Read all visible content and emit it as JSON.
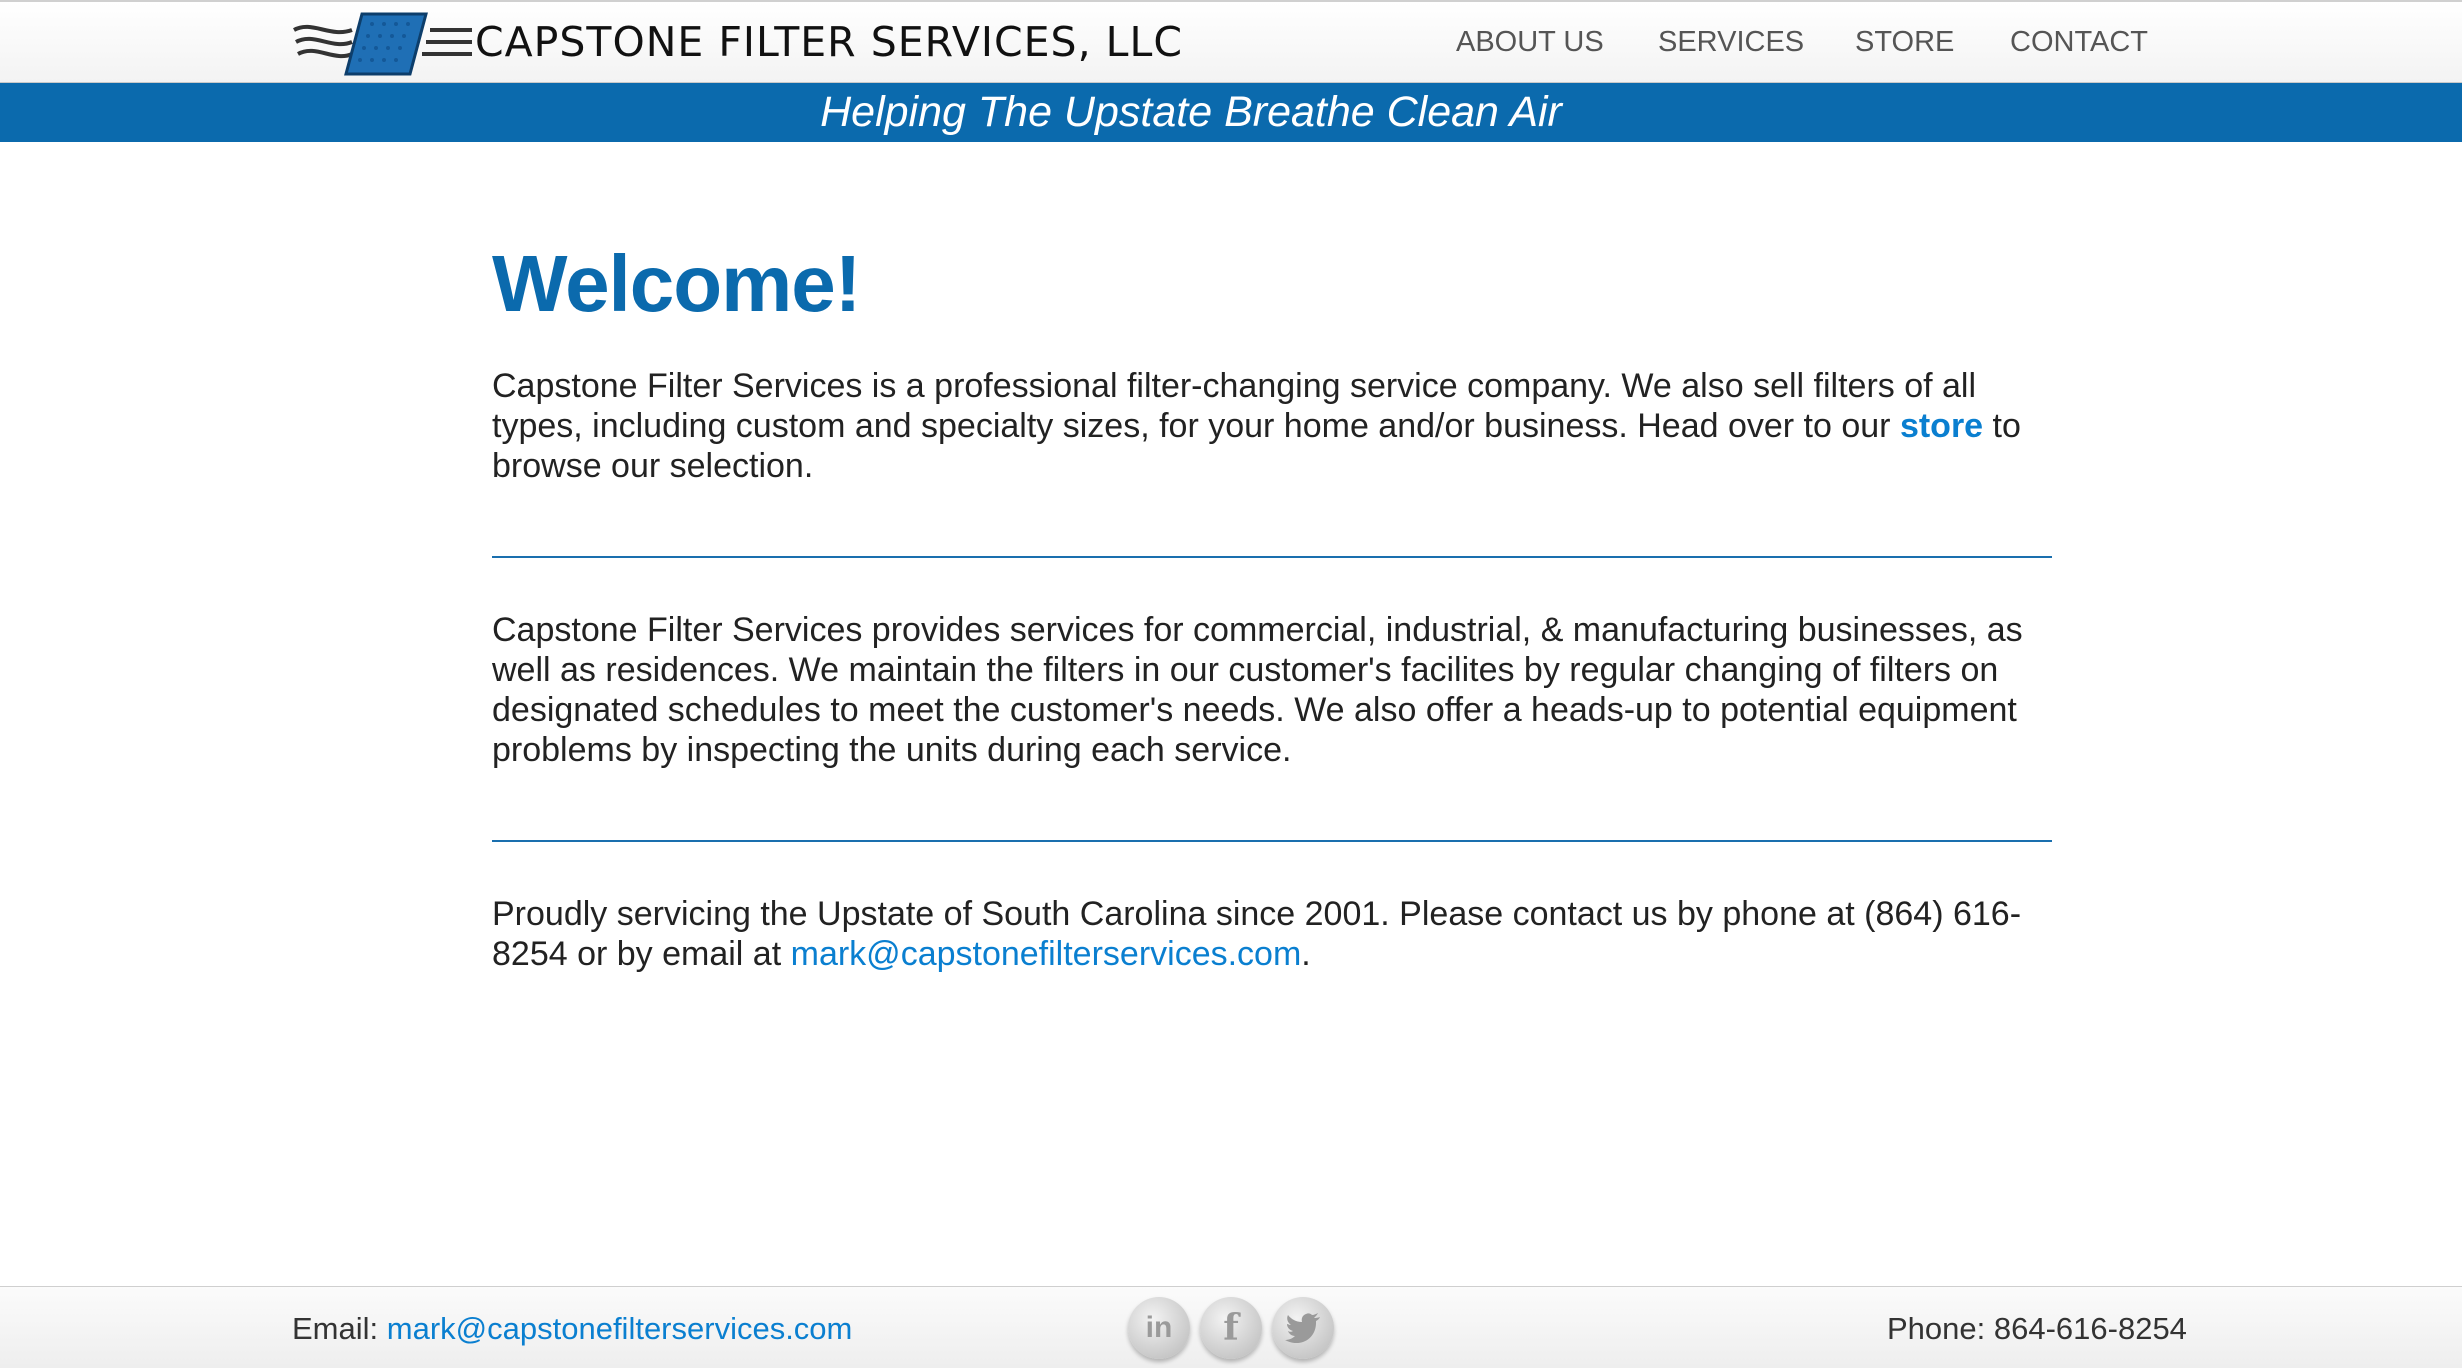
{
  "header": {
    "logo_text": "CAPSTONE FILTER SERVICES, LLC",
    "logo_icon": "filter-logo-icon",
    "nav": [
      {
        "label": "ABOUT US"
      },
      {
        "label": "SERVICES"
      },
      {
        "label": "STORE"
      },
      {
        "label": "CONTACT"
      }
    ]
  },
  "banner": {
    "tagline": "Helping The Upstate Breathe Clean Air"
  },
  "main": {
    "title": "Welcome!",
    "intro_text": "Capstone Filter Services is a professional filter-changing service company. We also sell filters of all types, including custom and specialty sizes, for your home and/or business. Head over to our",
    "intro_link": "store",
    "intro_tail": "to browse our selection.",
    "services_text": "Capstone Filter Services provides services for commercial, industrial, & manufacturing businesses, as well as residences. We maintain the filters in our customer's facilites by regular changing of filters on designated schedules to meet the customer's needs. We also offer a heads-up to potential equipment problems by inspecting the units during each service.",
    "contact_text": "Proudly servicing the Upstate of South Carolina since 2001. Please contact us by phone at (864) 616-8254 or by email at",
    "contact_email": "mark@capstonefilterservices.com",
    "contact_tail": "."
  },
  "footer": {
    "email_label": "Email:",
    "email": "mark@capstonefilterservices.com",
    "phone": "Phone: 864-616-8254",
    "social": [
      {
        "icon": "linkedin-icon",
        "glyph": "in"
      },
      {
        "icon": "facebook-icon",
        "glyph": "f"
      },
      {
        "icon": "twitter-icon",
        "glyph": "🐦"
      }
    ]
  },
  "colors": {
    "brand_blue": "#0b6aad",
    "link_blue": "#0a7fd0"
  }
}
